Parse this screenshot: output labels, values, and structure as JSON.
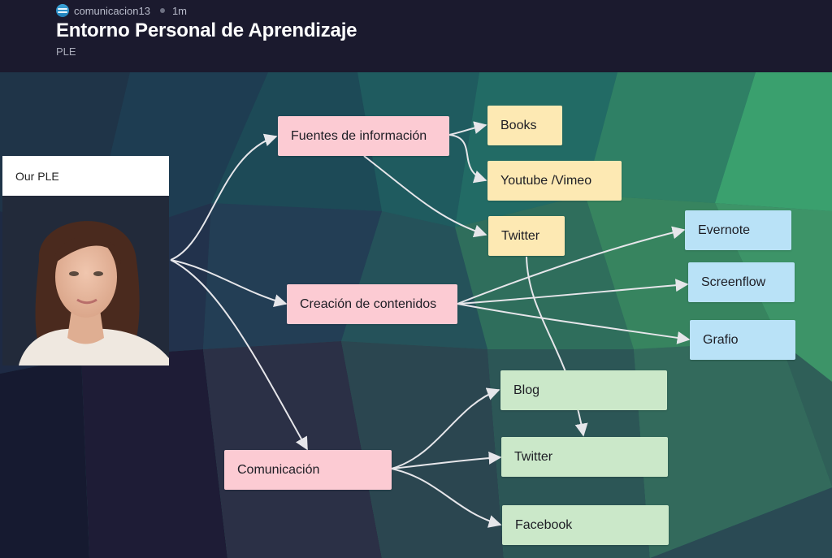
{
  "header": {
    "author": "comunicacion13",
    "author_icon": "globe-avatar-icon",
    "time_ago": "1m",
    "title": "Entorno Personal de Aprendizaje",
    "subtitle": "PLE"
  },
  "diagram": {
    "root": {
      "label": "Our PLE",
      "image": "portrait-photo"
    },
    "nodes": {
      "fuentes": {
        "label": "Fuentes de información",
        "color": "#fccbd3"
      },
      "books": {
        "label": "Books",
        "color": "#fde9b3"
      },
      "youtube": {
        "label": "Youtube /Vimeo",
        "color": "#fde9b3"
      },
      "twitter_fuentes": {
        "label": "Twitter",
        "color": "#fde9b3"
      },
      "creacion": {
        "label": "Creación de contenidos",
        "color": "#fccbd3"
      },
      "evernote": {
        "label": "Evernote",
        "color": "#b9e2f7"
      },
      "screenflow": {
        "label": "Screenflow",
        "color": "#b9e2f7"
      },
      "grafio": {
        "label": "Grafio",
        "color": "#b9e2f7"
      },
      "comunicacion": {
        "label": "Comunicación",
        "color": "#fccbd3"
      },
      "blog": {
        "label": "Blog",
        "color": "#cbe8c9"
      },
      "twitter_com": {
        "label": "Twitter",
        "color": "#cbe8c9"
      },
      "facebook": {
        "label": "Facebook",
        "color": "#cbe8c9"
      }
    },
    "edges": [
      [
        "root",
        "fuentes"
      ],
      [
        "root",
        "creacion"
      ],
      [
        "root",
        "comunicacion"
      ],
      [
        "fuentes",
        "books"
      ],
      [
        "fuentes",
        "youtube"
      ],
      [
        "fuentes",
        "twitter_fuentes"
      ],
      [
        "creacion",
        "evernote"
      ],
      [
        "creacion",
        "screenflow"
      ],
      [
        "creacion",
        "grafio"
      ],
      [
        "comunicacion",
        "blog"
      ],
      [
        "comunicacion",
        "twitter_com"
      ],
      [
        "comunicacion",
        "facebook"
      ],
      [
        "twitter_fuentes",
        "twitter_com"
      ]
    ]
  }
}
